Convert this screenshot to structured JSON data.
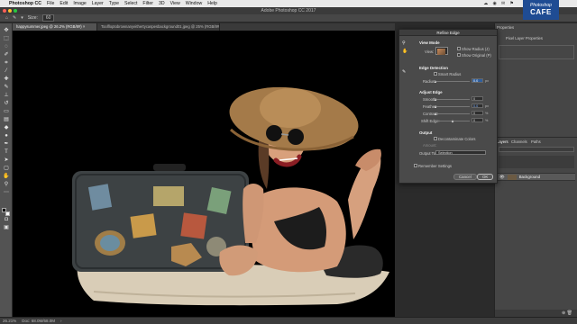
{
  "menubar": {
    "app_name": "Photoshop CC",
    "items": [
      "File",
      "Edit",
      "Image",
      "Layer",
      "Type",
      "Select",
      "Filter",
      "3D",
      "View",
      "Window",
      "Help"
    ],
    "right_icons": [
      "☁",
      "◉",
      "✉",
      "⚑"
    ]
  },
  "window": {
    "title": "Adobe Photoshop CC 2017"
  },
  "options_bar": {
    "size_label": "Size:",
    "size_value": "60"
  },
  "tabs": [
    {
      "label": "happysummer.jpeg @ 26.2% (RGB/8#) ×"
    },
    {
      "label": "Toolfloptobrownanyeithertycaspesbackground01.jpeg @ 25% (RGB/8#) ×"
    }
  ],
  "status": {
    "zoom": "26.21%",
    "doc": "Doc: 68.0M/68.0M"
  },
  "dialog": {
    "title": "Refine Edge",
    "view_mode": {
      "heading": "View Mode",
      "view_label": "View:",
      "show_radius": "Show Radius (J)",
      "show_original": "Show Original (P)"
    },
    "edge_detection": {
      "heading": "Edge Detection",
      "smart_radius": "Smart Radius",
      "radius_label": "Radius:",
      "radius_value": "0.0",
      "radius_unit": "px"
    },
    "adjust_edge": {
      "heading": "Adjust Edge",
      "rows": [
        {
          "label": "Smooth:",
          "value": "0",
          "unit": ""
        },
        {
          "label": "Feather:",
          "value": "0.0",
          "unit": "px"
        },
        {
          "label": "Contrast:",
          "value": "0",
          "unit": "%"
        },
        {
          "label": "Shift Edge:",
          "value": "0",
          "unit": "%"
        }
      ]
    },
    "output": {
      "heading": "Output",
      "decontaminate": "Decontaminate Colors",
      "amount_label": "Amount:",
      "output_to_label": "Output To:",
      "output_to_value": "Selection"
    },
    "remember": "Remember Settings",
    "cancel": "Cancel",
    "ok": "OK"
  },
  "right_panel": {
    "properties_tab": "Properties",
    "pixel_layer_props": "Pixel Layer Properties",
    "bottom_tabs": [
      "Layers",
      "Channels",
      "Paths"
    ],
    "layer_name": "Background"
  },
  "logo": {
    "line1": "Photoshop",
    "line2": "CAFE"
  },
  "colors": {
    "accent": "#2f5f9e",
    "logo_bg": "#1f4c93",
    "panel": "#464646",
    "canvas": "#000000"
  }
}
